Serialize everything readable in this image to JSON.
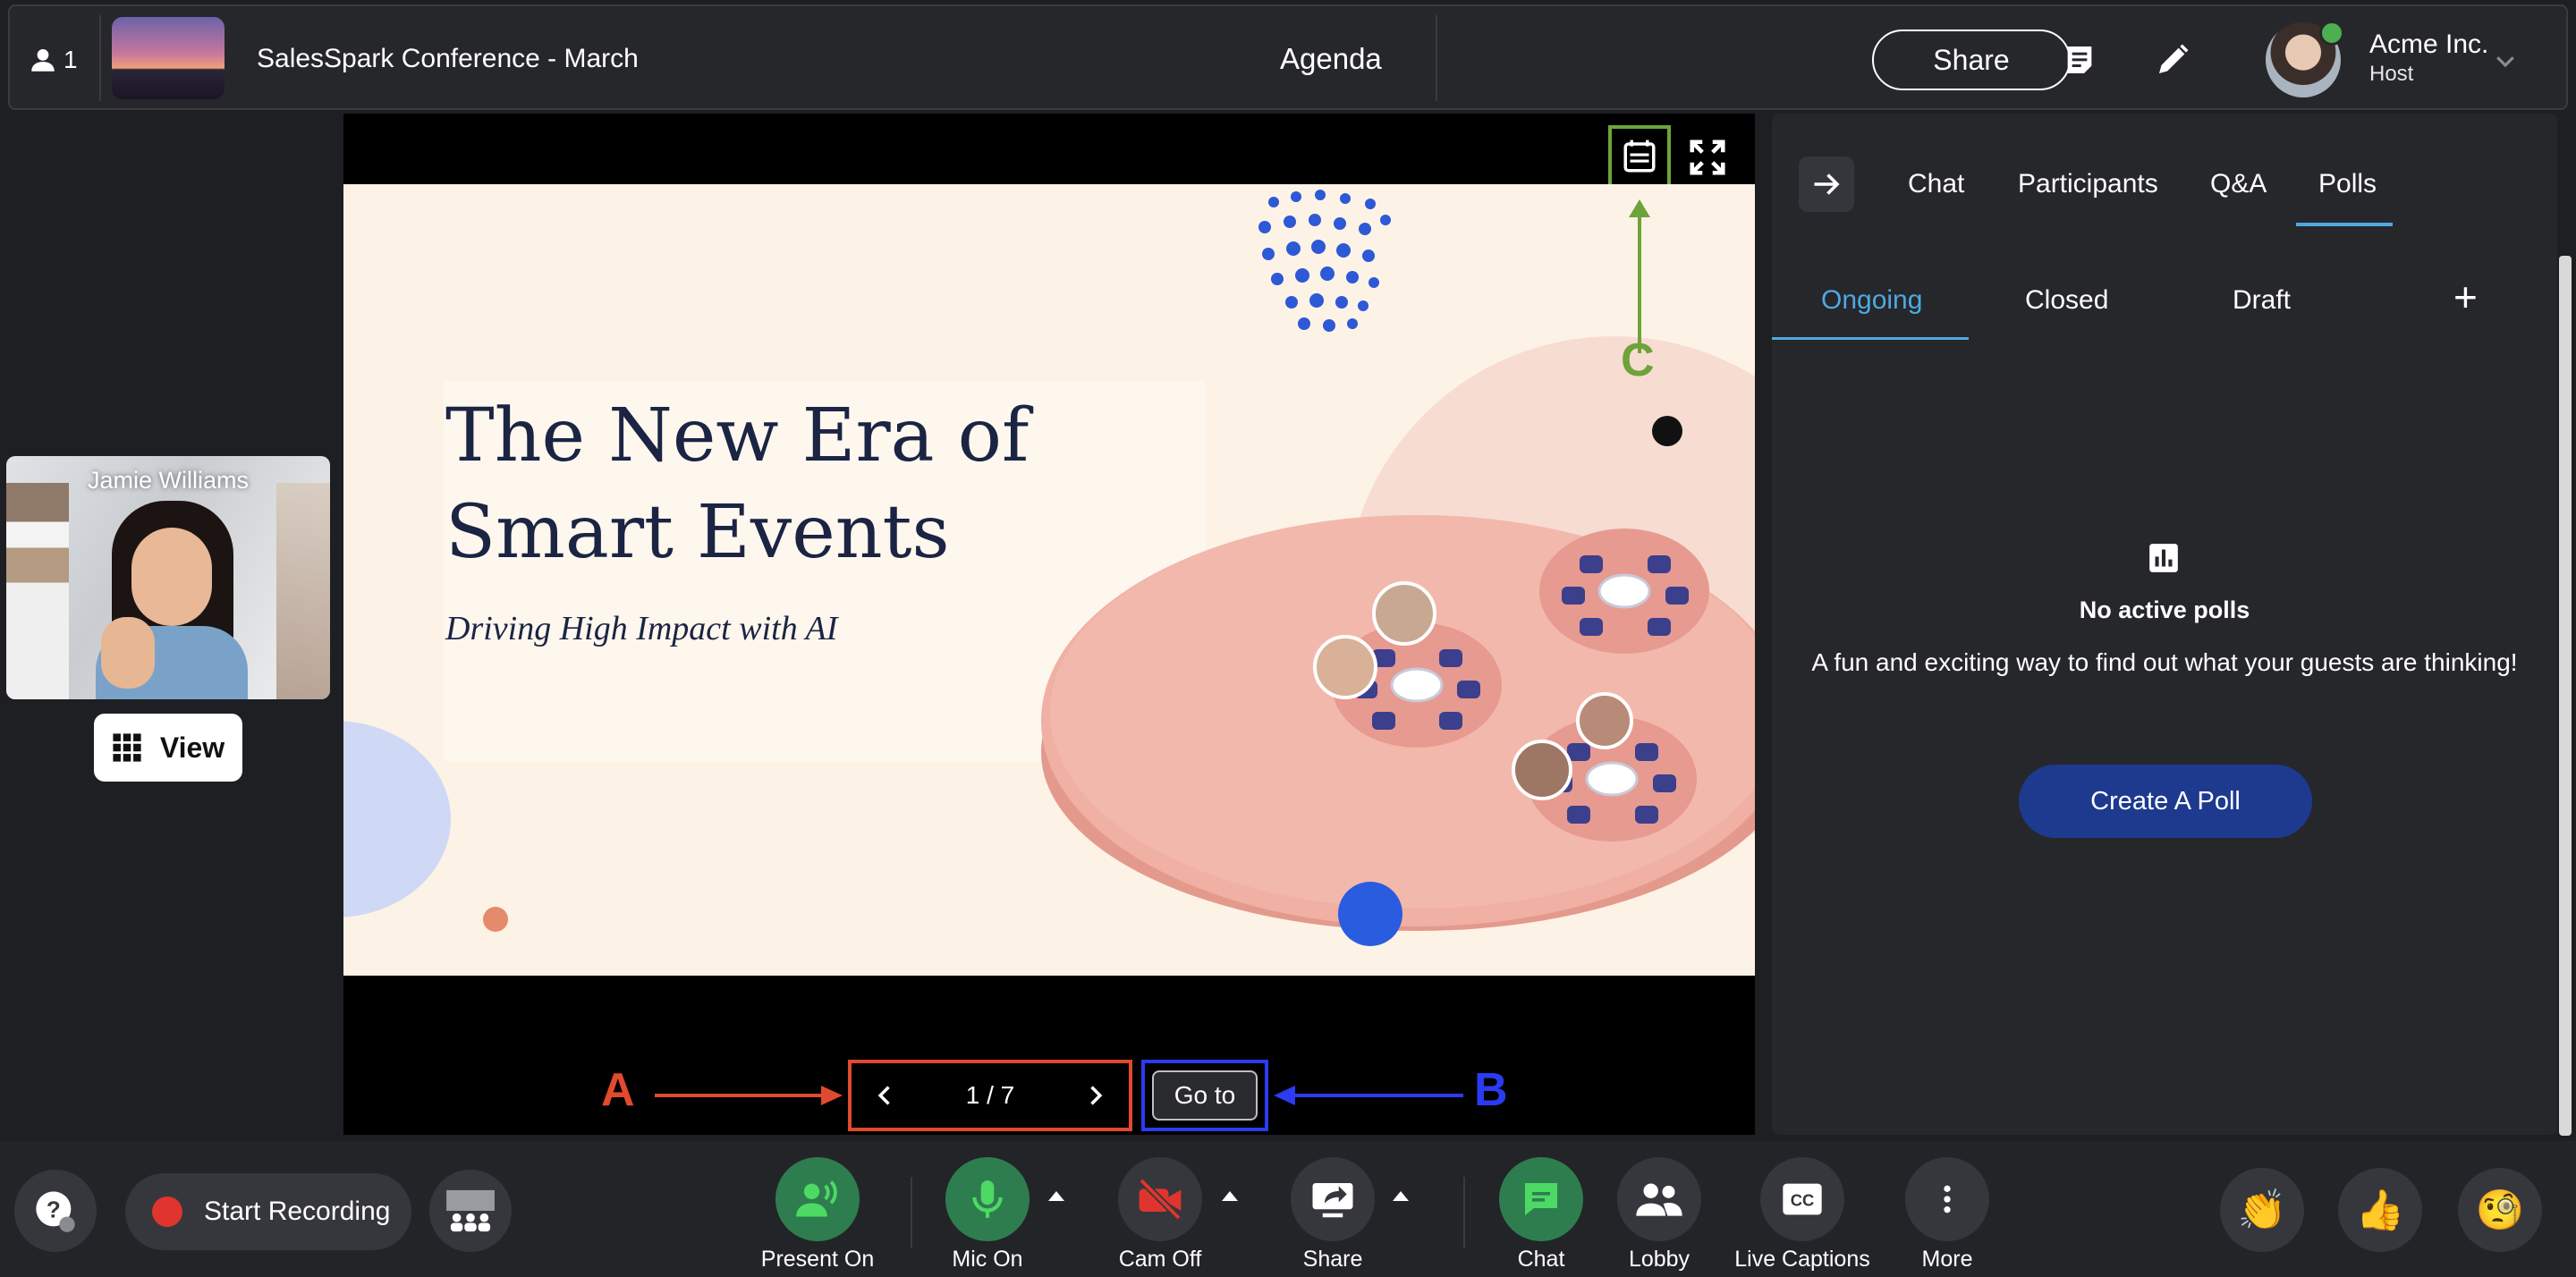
{
  "topbar": {
    "participant_count": "1",
    "event_title": "SalesSpark Conference - March",
    "agenda_label": "Agenda",
    "share_label": "Share",
    "org_name": "Acme Inc.",
    "role": "Host"
  },
  "self_view": {
    "name": "Jamie Williams",
    "view_label": "View"
  },
  "slide": {
    "title": "The New Era of Smart Events",
    "subtitle": "Driving High Impact with AI",
    "page_indicator": "1 / 7",
    "goto_label": "Go to",
    "annotations": {
      "a": "A",
      "b": "B",
      "c": "C"
    },
    "annotation_colors": {
      "a": "#e04a2e",
      "b": "#2b3bf2",
      "c": "#6ea33a"
    }
  },
  "panel": {
    "tabs": [
      "Chat",
      "Participants",
      "Q&A",
      "Polls"
    ],
    "active_tab": "Polls",
    "subtabs": [
      "Ongoing",
      "Closed",
      "Draft"
    ],
    "active_subtab": "Ongoing",
    "empty_title": "No active polls",
    "empty_desc": "A fun and exciting way to find out what your guests are thinking!",
    "create_label": "Create A Poll"
  },
  "bottombar": {
    "record_label": "Start Recording",
    "controls": [
      "Present On",
      "Mic On",
      "Cam Off",
      "Share",
      "Chat",
      "Lobby",
      "Live Captions",
      "More"
    ]
  },
  "colors": {
    "accent": "#4fa9e0",
    "green_active": "#2e7d4f",
    "mic_green": "#4cd964",
    "cam_red": "#e0342e",
    "primary_button": "#1d3a8f"
  }
}
